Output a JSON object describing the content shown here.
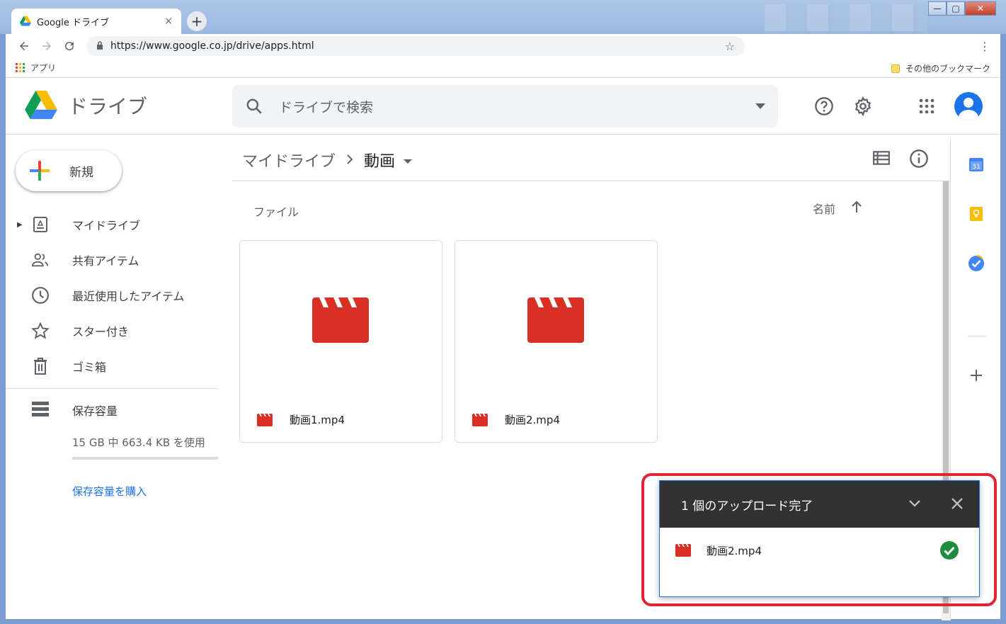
{
  "browser": {
    "tab_title": "Google ドライブ",
    "tab_close": "×",
    "new_tab": "+",
    "url": "https://www.google.co.jp/drive/apps.html",
    "bookmarks_apps": "アプリ",
    "bookmarks_other": "その他のブックマーク"
  },
  "window_controls": {
    "minimize": "—",
    "maximize": "▢",
    "close": "✕"
  },
  "header": {
    "logo_text": "ドライブ",
    "search_placeholder": "ドライブで検索"
  },
  "sidebar": {
    "new_label": "新規",
    "items": [
      {
        "label": "マイドライブ",
        "icon": "my-drive-icon"
      },
      {
        "label": "共有アイテム",
        "icon": "shared-icon"
      },
      {
        "label": "最近使用したアイテム",
        "icon": "clock-icon"
      },
      {
        "label": "スター付き",
        "icon": "star-icon"
      },
      {
        "label": "ゴミ箱",
        "icon": "trash-icon"
      }
    ],
    "storage_label": "保存容量",
    "storage_used": "15 GB 中 663.4 KB を使用",
    "storage_fraction": 4e-05,
    "buy_storage": "保存容量を購入"
  },
  "main": {
    "breadcrumb_root": "マイドライブ",
    "breadcrumb_current": "動画",
    "section_label": "ファイル",
    "sort_label": "名前",
    "files": [
      {
        "name": "動画1.mp4"
      },
      {
        "name": "動画2.mp4"
      }
    ]
  },
  "upload": {
    "title": "1 個のアップロード完了",
    "item_name": "動画2.mp4"
  },
  "colors": {
    "video_red": "#d93025",
    "check_green": "#1e8e3e",
    "accent_blue": "#1a73e8",
    "highlight_red": "#e02434"
  }
}
